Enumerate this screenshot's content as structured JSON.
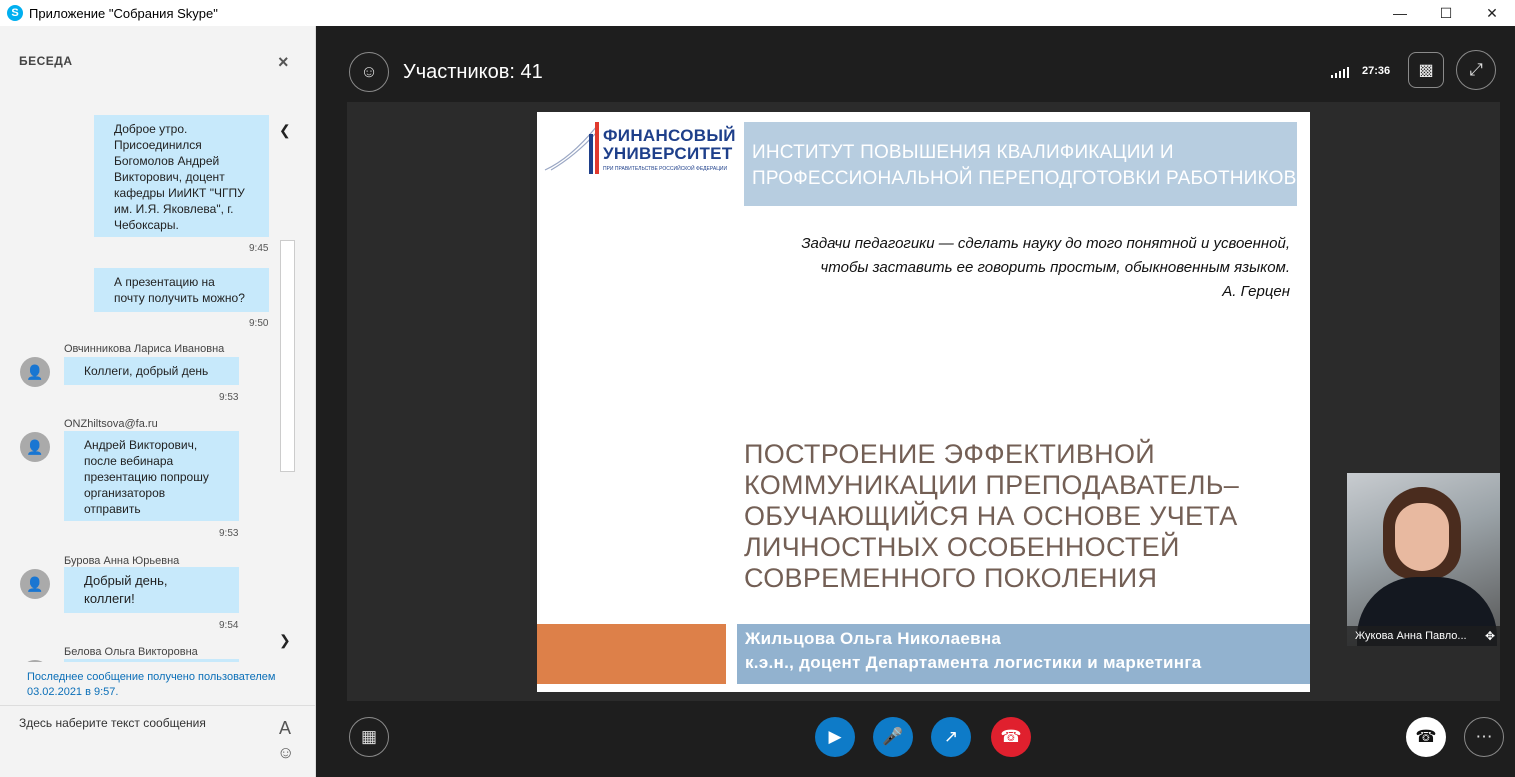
{
  "window": {
    "app_icon": "skype-icon",
    "title": "Приложение \"Собрания Skype\"",
    "controls": [
      "minimize-icon",
      "maximize-icon",
      "close-icon"
    ]
  },
  "chat": {
    "header": "БЕСЕДА",
    "close_icon": "×",
    "messages": [
      {
        "sender": "",
        "text": "Доброе утро.\nПрисоединился\nБогомолов Андрей\nВикторович, доцент\nкафедры ИиИКТ \"ЧГПУ\nим. И.Я. Яковлева\", г.\nЧебоксары.",
        "time": "9:45",
        "own": true
      },
      {
        "sender": "",
        "text": "А презентацию на\nпочту получить можно?",
        "time": "9:50",
        "own": true
      },
      {
        "sender": "Овчинникова Лариса Ивановна",
        "text": "Коллеги, добрый день",
        "time": "9:53",
        "own": false
      },
      {
        "sender": "ONZhiltsova@fa.ru",
        "text": "Андрей Викторович,\nпосле вебинара\nпрезентацию попрошу\nорганизаторов\nотправить",
        "time": "9:53",
        "own": false
      },
      {
        "sender": "Бурова Анна Юрьевна",
        "text": "Добрый день,\nколлеги!",
        "time": "9:54",
        "own": false
      },
      {
        "sender": "Белова Ольга Викторовна",
        "text": "",
        "time": "",
        "own": false
      }
    ],
    "last_message_info": "Последнее сообщение получено пользователем 03.02.2021 в 9:57.",
    "input_placeholder": "Здесь наберите текст сообщения",
    "font_label": "A",
    "emoji": "☺"
  },
  "stage": {
    "participants_label": "Участников: 41",
    "timer": "27:36",
    "slide": {
      "logo_line1": "ФИНАНСОВЫЙ",
      "logo_line2": "УНИВЕРСИТЕТ",
      "logo_sub": "ПРИ ПРАВИТЕЛЬСТВЕ РОССИЙСКОЙ ФЕДЕРАЦИИ",
      "institute_line1": "ИНСТИТУТ ПОВЫШЕНИЯ КВАЛИФИКАЦИИ И",
      "institute_line2": "ПРОФЕССИОНАЛЬНОЙ ПЕРЕПОДГОТОВКИ РАБОТНИКОВ",
      "quote_line1": "Задачи педагогики — сделать науку до того понятной и усвоенной,",
      "quote_line2": "чтобы заставить ее говорить простым, обыкновенным языком.",
      "quote_author": "А. Герцен",
      "title_line1": "ПОСТРОЕНИЕ ЭФФЕКТИВНОЙ",
      "title_line2": "КОММУНИКАЦИИ ПРЕПОДАВАТЕЛЬ–",
      "title_line3": "ОБУЧАЮЩИЙСЯ НА ОСНОВЕ УЧЕТА",
      "title_line4": "ЛИЧНОСТНЫХ ОСОБЕННОСТЕЙ",
      "title_line5": "СОВРЕМЕННОГО ПОКОЛЕНИЯ",
      "author_name": "Жильцова Ольга Николаевна",
      "author_title": "к.э.н., доцент Департамента логистики и маркетинга",
      "colors": {
        "institute_bg": "#b7cde0",
        "title": "#735f55",
        "orange": "#dd8049",
        "author_bg": "#92b2cf"
      }
    },
    "pip_name": "Жукова Анна Павло...",
    "buttons": {
      "video": "video-camera-icon",
      "mic": "microphone-muted-icon",
      "share": "screen-share-icon",
      "hangup": "hang-up-icon",
      "phone": "phone-icon",
      "more": "more-options-icon"
    },
    "accent_blue": "#0e7bc8",
    "hangup_red": "#e0202e"
  }
}
